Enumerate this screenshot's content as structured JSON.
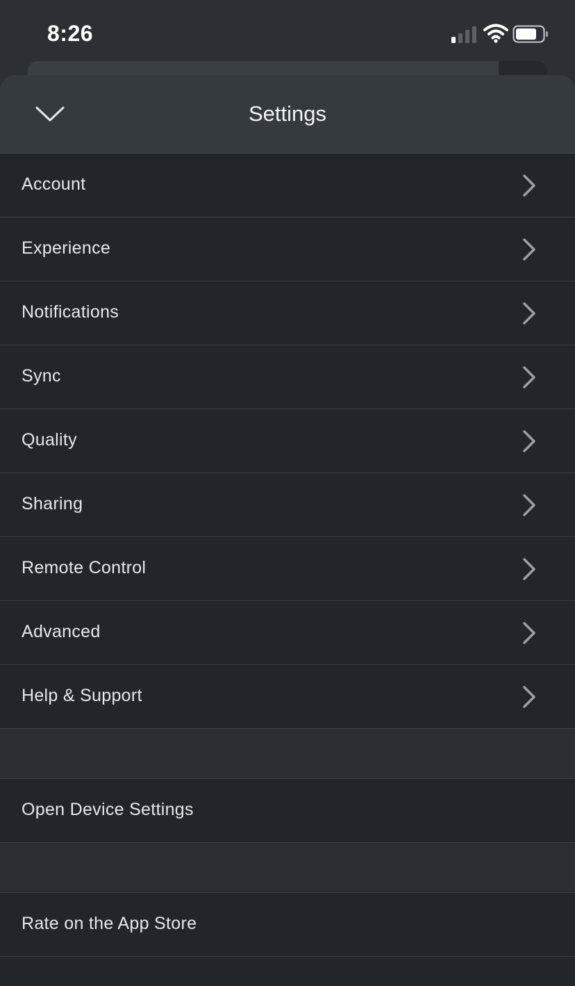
{
  "status_bar": {
    "time": "8:26",
    "icons": [
      "cellular-signal-icon",
      "wifi-icon",
      "battery-icon"
    ],
    "signal_bars_active": 1,
    "signal_bars_total": 4
  },
  "header": {
    "title": "Settings",
    "collapse_icon": "chevron-down-icon"
  },
  "settings_items": [
    {
      "label": "Account"
    },
    {
      "label": "Experience"
    },
    {
      "label": "Notifications"
    },
    {
      "label": "Sync"
    },
    {
      "label": "Quality"
    },
    {
      "label": "Sharing"
    },
    {
      "label": "Remote Control"
    },
    {
      "label": "Advanced"
    },
    {
      "label": "Help & Support"
    }
  ],
  "actions": {
    "open_device_settings": "Open Device Settings",
    "rate_app_store": "Rate on the App Store"
  },
  "colors": {
    "background": "#2c3035",
    "sheet": "#222529",
    "header": "#353a3f",
    "text": "#e6e8ea",
    "chevron": "#9ba0a6"
  }
}
